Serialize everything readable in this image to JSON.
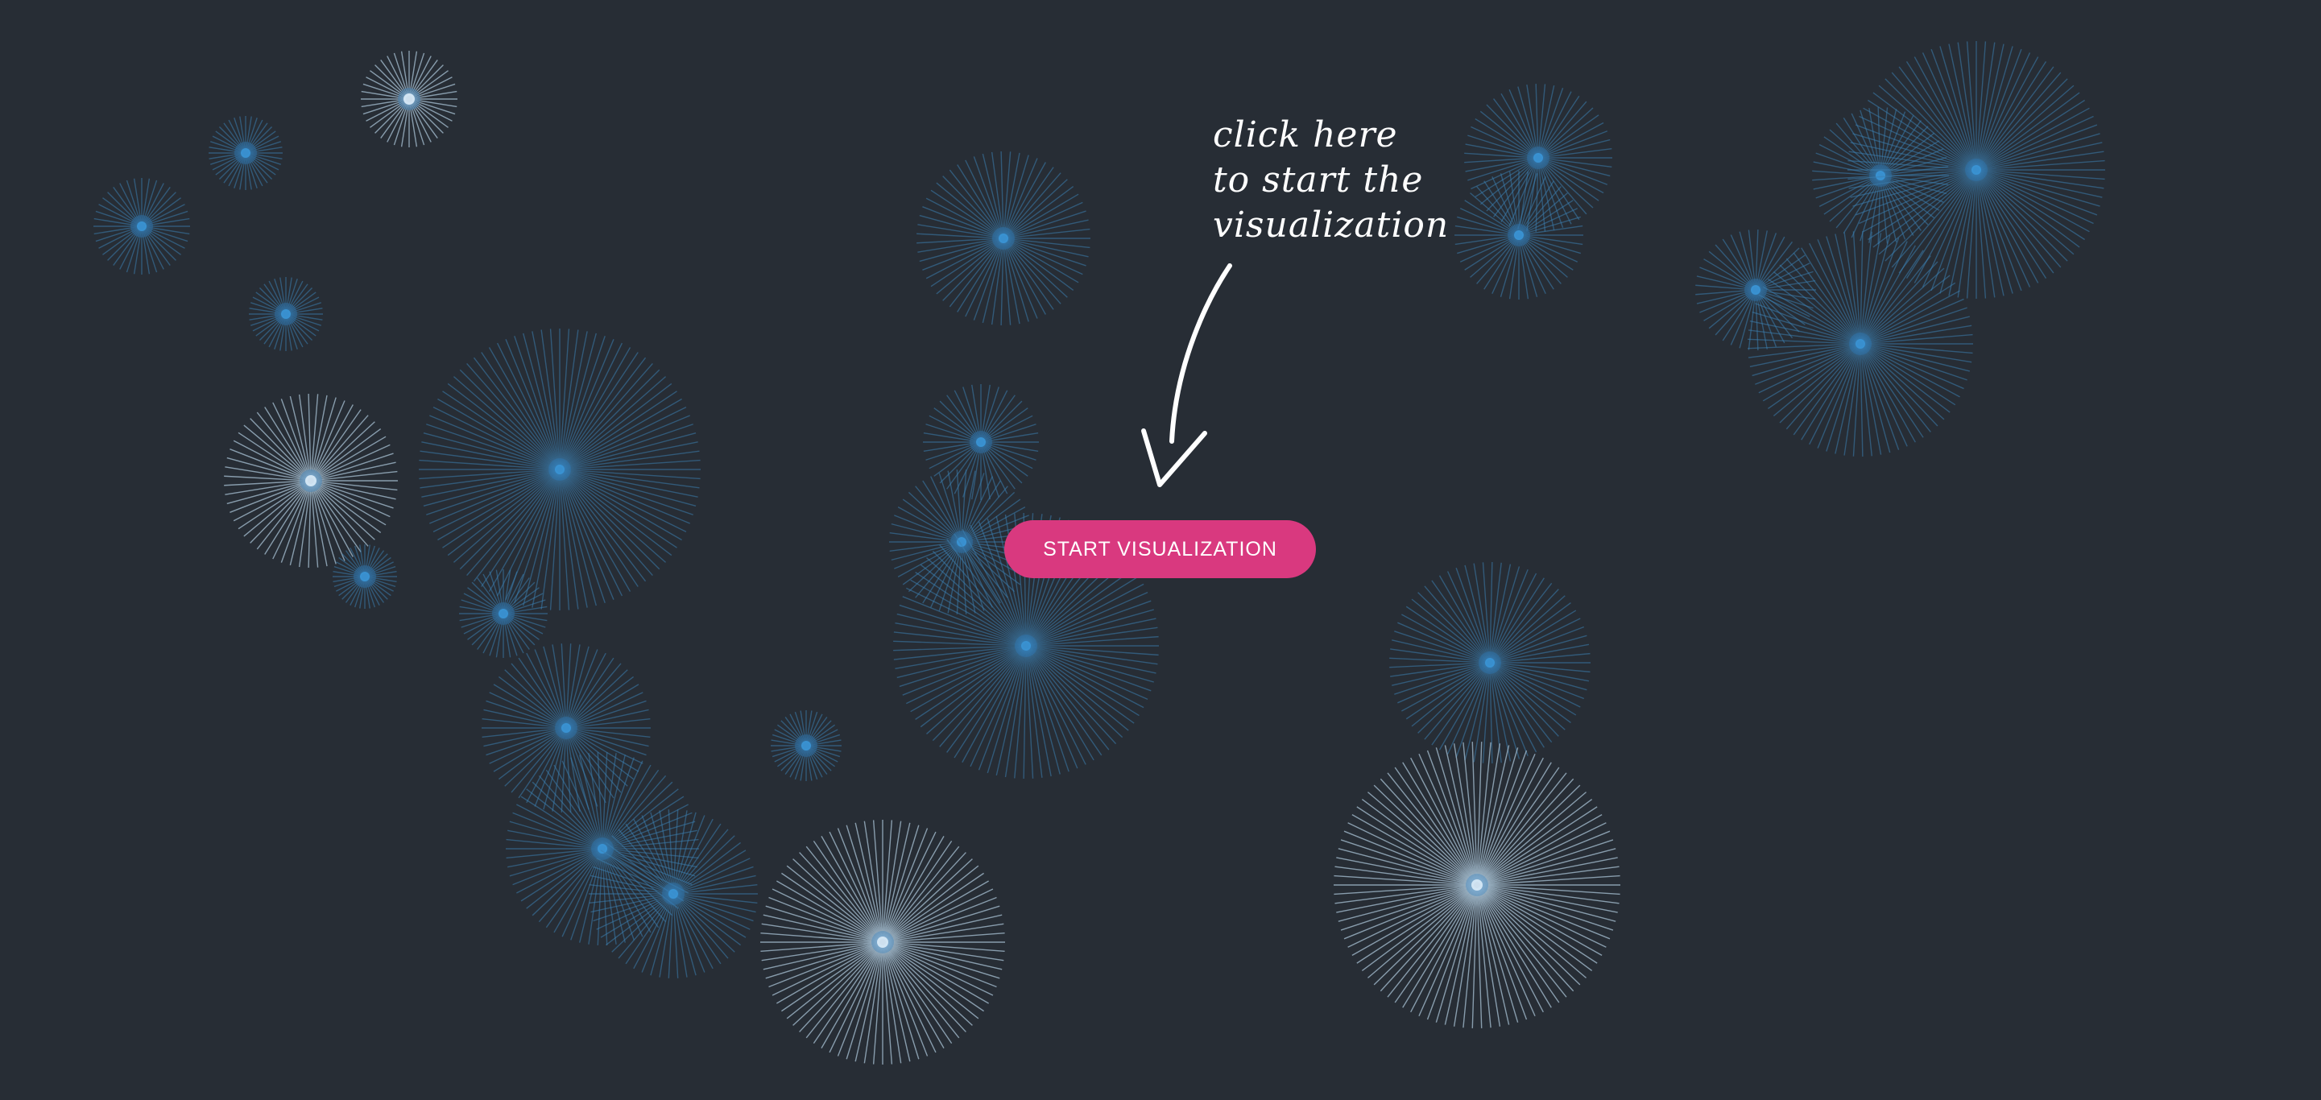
{
  "hint": {
    "line1": "click here",
    "line2": "to start the",
    "line3": "visualization"
  },
  "start_button": {
    "label": "START VISUALIZATION"
  },
  "colors": {
    "background": "#272d35",
    "button": "#d9397f",
    "burst_blue": "#3d7fb0",
    "burst_pale": "#a9c3d6",
    "text": "#ffffff"
  }
}
